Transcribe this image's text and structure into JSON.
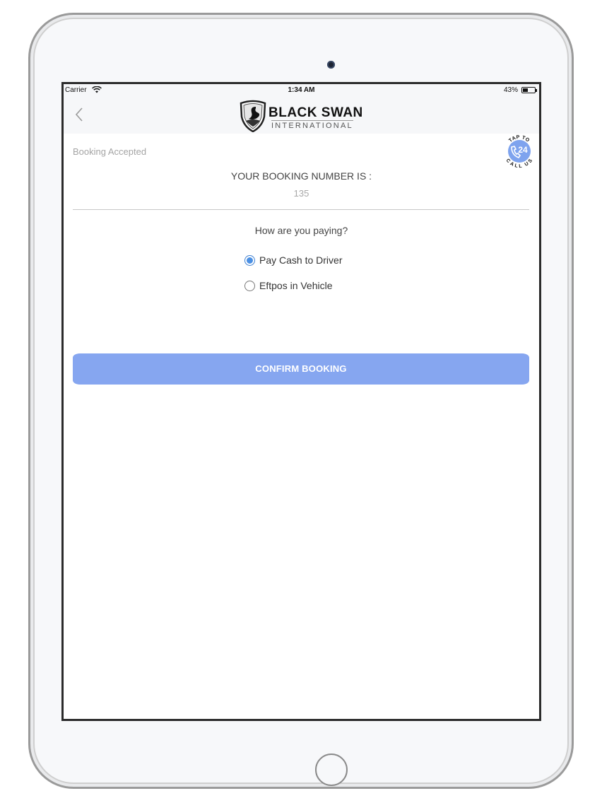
{
  "status_bar": {
    "carrier": "Carrier",
    "time": "1:34 AM",
    "battery": "43%"
  },
  "nav": {
    "back_icon": "chevron-left-icon",
    "logo": {
      "title": "BLACK SWAN",
      "subtitle": "INTERNATIONAL"
    }
  },
  "call_badge": {
    "top_text": "TAP TO",
    "number": "24",
    "bottom_text": "CALL US",
    "color": "#7ea3ee"
  },
  "booking": {
    "status": "Booking Accepted",
    "number_label": "YOUR BOOKING NUMBER IS :",
    "number": "135"
  },
  "payment": {
    "question": "How are you paying?",
    "options": [
      {
        "label": "Pay Cash to Driver",
        "selected": true
      },
      {
        "label": "Eftpos in Vehicle",
        "selected": false
      }
    ]
  },
  "confirm_button": {
    "label": "CONFIRM BOOKING",
    "color": "#86a6f0"
  }
}
